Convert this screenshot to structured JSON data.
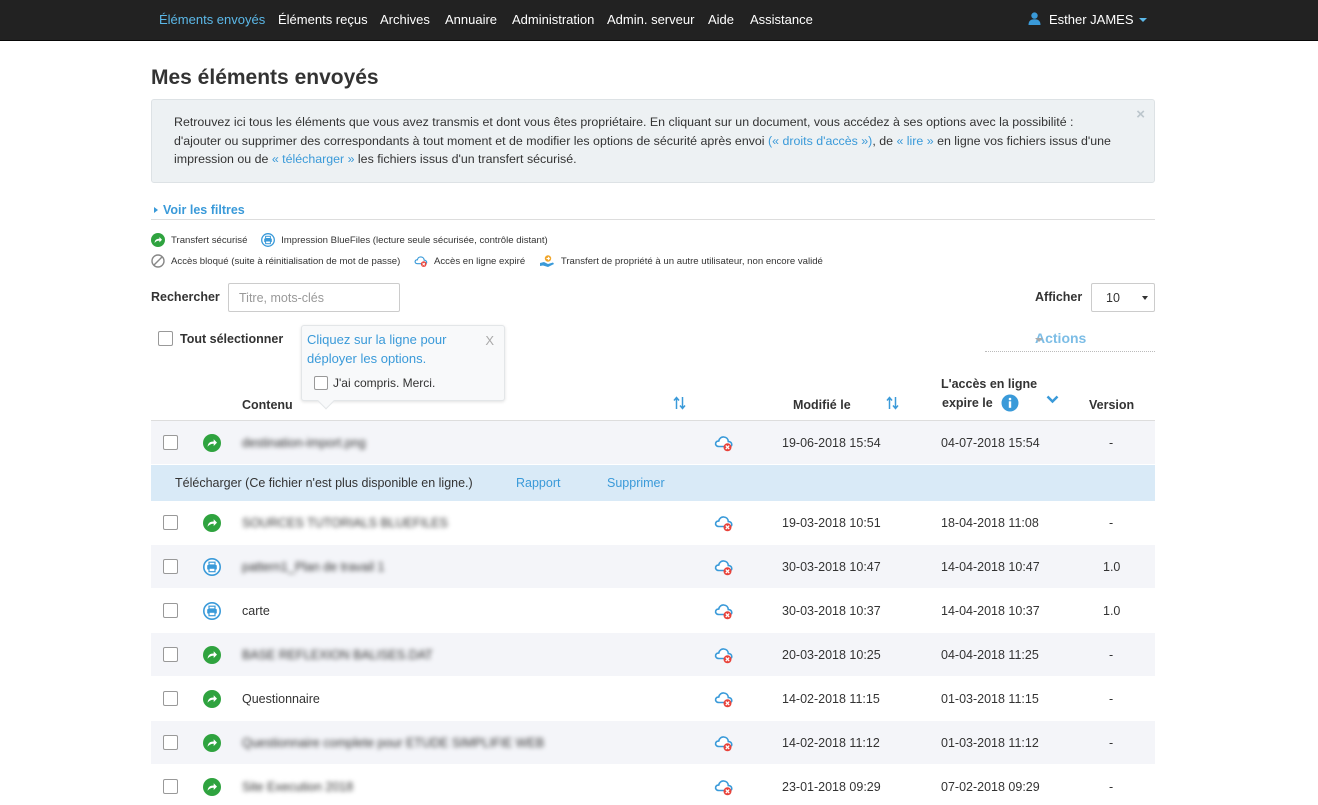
{
  "nav": {
    "items": [
      {
        "label": "Éléments envoyés",
        "active": true
      },
      {
        "label": "Éléments reçus"
      },
      {
        "label": "Archives"
      },
      {
        "label": "Annuaire"
      },
      {
        "label": "Administration"
      },
      {
        "label": "Admin. serveur"
      },
      {
        "label": "Aide"
      },
      {
        "label": "Assistance"
      }
    ],
    "user": "Esther JAMES"
  },
  "page": {
    "title": "Mes éléments envoyés"
  },
  "info": {
    "t1": "Retrouvez ici tous les éléments que vous avez transmis et dont vous êtes propriétaire. En cliquant sur un document, vous accédez à ses options avec la possibilité : d'ajouter ou supprimer des correspondants à tout moment et de modifier les options de sécurité après envoi ",
    "link_rights": "(« droits d'accès »)",
    "t2": ", de ",
    "link_read": "« lire »",
    "t3": " en ligne vos fichiers issus d'une impression ou de ",
    "link_download": "« télécharger »",
    "t4": " les fichiers issus d'un transfert sécurisé.",
    "close": "×"
  },
  "filters": {
    "label": "Voir les filtres"
  },
  "legend": {
    "secure_transfer": "Transfert sécurisé",
    "print": "Impression BlueFiles (lecture seule sécurisée, contrôle distant)",
    "blocked": "Accès bloqué (suite à réinitialisation de mot de passe)",
    "expired": "Accès en ligne expiré",
    "ownership": "Transfert de propriété à un autre utilisateur, non encore validé"
  },
  "search": {
    "label": "Rechercher",
    "placeholder": "Titre, mots-clés"
  },
  "show": {
    "label": "Afficher",
    "value": "10"
  },
  "select_all": "Tout sélectionner",
  "tooltip": {
    "text": "Cliquez sur la ligne pour déployer les options.",
    "close": "X",
    "ack": "J'ai compris. Merci."
  },
  "actions": {
    "label": "Actions"
  },
  "columns": {
    "content": "Contenu",
    "modified": "Modifié le",
    "expires_l1": "L'accès en ligne",
    "expires_l2": "expire le",
    "version": "Version"
  },
  "colors": {
    "accent": "#3a9ad9",
    "green": "#2fa33f",
    "nav_bg": "#222222",
    "row_alt": "#f4f5f9",
    "action_row": "#d9eaf7"
  },
  "rows": [
    {
      "type": "transfer",
      "name": "destination-import.png",
      "blurred": true,
      "modified": "19-06-2018 15:54",
      "expires": "04-07-2018 15:54",
      "version": "-"
    },
    {
      "type": "transfer",
      "name": "SOURCES TUTORIALS BLUEFILES",
      "blurred": true,
      "modified": "19-03-2018 10:51",
      "expires": "18-04-2018 11:08",
      "version": "-"
    },
    {
      "type": "print",
      "name": "pattern1_Plan de travail 1",
      "blurred": true,
      "modified": "30-03-2018 10:47",
      "expires": "14-04-2018 10:47",
      "version": "1.0"
    },
    {
      "type": "print",
      "name": "carte",
      "blurred": false,
      "modified": "30-03-2018 10:37",
      "expires": "14-04-2018 10:37",
      "version": "1.0"
    },
    {
      "type": "transfer",
      "name": "BASE REFLEXION BALISES.DAT",
      "blurred": true,
      "modified": "20-03-2018 10:25",
      "expires": "04-04-2018 11:25",
      "version": "-"
    },
    {
      "type": "transfer",
      "name": "Questionnaire",
      "blurred": false,
      "modified": "14-02-2018 11:15",
      "expires": "01-03-2018 11:15",
      "version": "-"
    },
    {
      "type": "transfer",
      "name": "Questionnaire complete pour ETUDE SIMPLIFIE WEB",
      "blurred": true,
      "modified": "14-02-2018 11:12",
      "expires": "01-03-2018 11:12",
      "version": "-"
    },
    {
      "type": "transfer",
      "name": "Site Execution 2018",
      "blurred": true,
      "modified": "23-01-2018 09:29",
      "expires": "07-02-2018 09:29",
      "version": "-"
    }
  ],
  "expanded_row": {
    "download": "Télécharger (Ce fichier n'est plus disponible en ligne.)",
    "report": "Rapport",
    "delete": "Supprimer"
  }
}
